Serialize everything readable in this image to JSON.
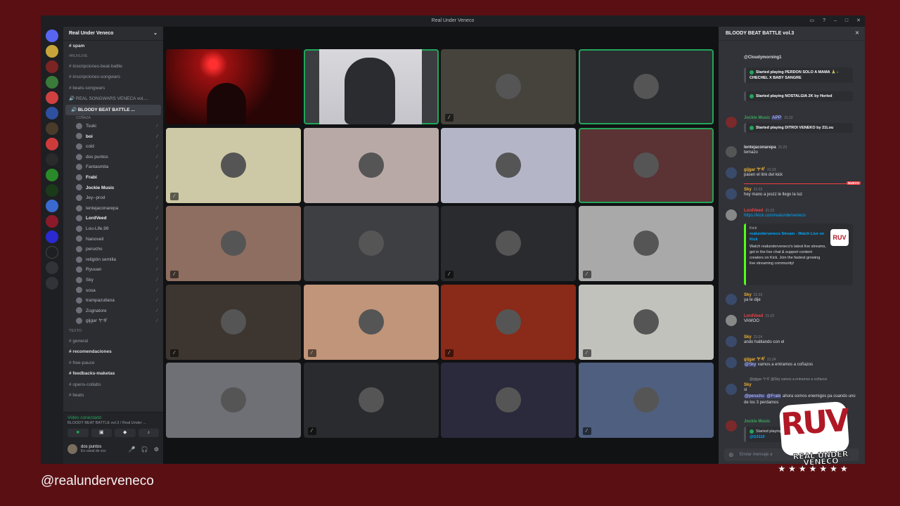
{
  "window": {
    "title": "Real Under Veneco"
  },
  "server": {
    "name": "Real Under Veneco"
  },
  "channels_top": [
    {
      "label": "spam",
      "kind": "text",
      "bright": true
    }
  ],
  "category_ruvlive": "#RUVLIVE",
  "channels_ruv": [
    {
      "label": "inscripciones-beat-battle",
      "kind": "text"
    },
    {
      "label": "inscripciones-songwars",
      "kind": "text"
    },
    {
      "label": "beats-songwars",
      "kind": "text"
    },
    {
      "label": "REAL SONGWARS VENECA vol....",
      "kind": "voice"
    }
  ],
  "active_voice": {
    "label": "BLOODY BEAT BATTLE ...",
    "sub": "COÑAZA"
  },
  "voice_users": [
    {
      "name": "Tsuki"
    },
    {
      "name": "boi",
      "bright": true
    },
    {
      "name": "cold"
    },
    {
      "name": "dos puntos"
    },
    {
      "name": "Fantasmita"
    },
    {
      "name": "Frabi",
      "bright": true
    },
    {
      "name": "Jockie Music",
      "bright": true
    },
    {
      "name": "Jey--prod"
    },
    {
      "name": "lentejaconarepa"
    },
    {
      "name": "LordVeed",
      "bright": true
    },
    {
      "name": "Lou-Life.99"
    },
    {
      "name": "Nanoveil"
    },
    {
      "name": "perucho"
    },
    {
      "name": "religión semilla"
    },
    {
      "name": "Ryuuan"
    },
    {
      "name": "Sky"
    },
    {
      "name": "sosa"
    },
    {
      "name": "trampazullana"
    },
    {
      "name": "Zognatore"
    },
    {
      "name": "gijgar ヤギ"
    }
  ],
  "category_texto": "Texto",
  "channels_texto": [
    {
      "label": "general",
      "kind": "text"
    },
    {
      "label": "recomendaciones",
      "kind": "text",
      "bright": true
    },
    {
      "label": "free-pauce",
      "kind": "text"
    },
    {
      "label": "feedbacks-maketas",
      "kind": "text",
      "bright": true
    },
    {
      "label": "opens-collabs",
      "kind": "text"
    },
    {
      "label": "beats",
      "kind": "text"
    }
  ],
  "voice_panel": {
    "status": "Video conectado",
    "channel": "BLOODY BEAT BATTLE vol.3 / Real Under ...",
    "user_name": "dos puntos",
    "user_status": "En canal de voz"
  },
  "tiles": [
    {
      "bg": "#3a0d0d",
      "speaking": false,
      "muted": false,
      "video": "red"
    },
    {
      "bg": "#3b3d40",
      "speaking": true,
      "muted": false,
      "video": "face"
    },
    {
      "bg": "#45433c",
      "speaking": false,
      "muted": true
    },
    {
      "bg": "#2b2d31",
      "speaking": true,
      "muted": false
    },
    {
      "bg": "#cdc9a6",
      "speaking": false,
      "muted": true
    },
    {
      "bg": "#b8a9a7",
      "speaking": false,
      "muted": false
    },
    {
      "bg": "#b4b6c8",
      "speaking": false,
      "muted": false
    },
    {
      "bg": "#5b3335",
      "speaking": true,
      "muted": false
    },
    {
      "bg": "#8e6e60",
      "speaking": false,
      "muted": true
    },
    {
      "bg": "#3e3f43",
      "speaking": false,
      "muted": false
    },
    {
      "bg": "#2a2b2e",
      "speaking": false,
      "muted": true
    },
    {
      "bg": "#a9a9a9",
      "speaking": false,
      "muted": true
    },
    {
      "bg": "#3d3630",
      "speaking": false,
      "muted": true
    },
    {
      "bg": "#c19579",
      "speaking": false,
      "muted": true
    },
    {
      "bg": "#8a2a18",
      "speaking": false,
      "muted": true
    },
    {
      "bg": "#c2c2bc",
      "speaking": false,
      "muted": true
    },
    {
      "bg": "#6f7075",
      "speaking": false,
      "muted": false
    },
    {
      "bg": "#2a2b2e",
      "speaking": false,
      "muted": true
    },
    {
      "bg": "#2b2a3c",
      "speaking": false,
      "muted": false
    },
    {
      "bg": "#4f5f80",
      "speaking": false,
      "muted": true
    }
  ],
  "chat": {
    "title": "BLOODY BEAT BATTLE vol.3",
    "messages": [
      {
        "author": "",
        "time": "",
        "text": "@Cloudymorning1"
      },
      {
        "author": "",
        "time": "",
        "text": "Started playing PERDON SOLO A MAMA 🙏 - CHECHEL X BABY SANGRE"
      },
      {
        "author": "",
        "time": "",
        "text": "Started playing NOSTALGIA 2K by Horled"
      },
      {
        "author": "Jockie Music",
        "time": "21:22",
        "text": "Started playing DITROI VENEKO by 21Lou",
        "color": "#3ba55d"
      },
      {
        "author": "lentejaconarepa",
        "time": "21:23",
        "text": "temazo",
        "color": "#dbdee1"
      },
      {
        "author": "gijgar ヤギ",
        "time": "21:23",
        "text": "pasen el link del kick",
        "color": "#f0b232"
      },
      {
        "author": "Sky",
        "time": "21:23",
        "text": "hey mano a jeszz le llego la luz",
        "color": "#f0b232"
      },
      {
        "author": "LordVeed",
        "time": "21:23",
        "text": "https://kick.com/realunderveneco",
        "color": "#ed4245"
      },
      {
        "author": "Sky",
        "time": "21:23",
        "text": "ya le dije",
        "color": "#f0b232"
      },
      {
        "author": "LordVeed",
        "time": "21:23",
        "text": "VAMOO",
        "color": "#ed4245"
      },
      {
        "author": "Sky",
        "time": "21:24",
        "text": "ando hablando con el",
        "color": "#f0b232"
      },
      {
        "author": "gijgar ヤギ",
        "time": "21:24",
        "text": "vamos a entramos a coñazos",
        "color": "#f0b232"
      },
      {
        "author": "Sky",
        "time": "",
        "text": "si",
        "color": "#f0b232"
      },
      {
        "author": "",
        "time": "",
        "text": "ahora somos enemigos pa cuando uno de los 3 perdamos"
      },
      {
        "author": "Jockie Music",
        "time": "",
        "text": "Started playing",
        "color": "#3ba55d"
      }
    ],
    "embed_kick": {
      "provider": "Kick",
      "title": "realunderveneco Stream - Watch Live on Kick",
      "desc": "Watch realunderveneco's latest live streams, get in the live chat & support content creators on Kick. Join the fastest growing live streaming community!"
    },
    "new_label": "NUEVO",
    "reply_text": "@gijgar ヤギ @Sky vamos a entramos a coñazos",
    "mention_sky": "@Sky",
    "mention_perucho": "@perucho",
    "mention_frabi": "@Frabi",
    "app_badge": "APP",
    "last_track": "@G3110",
    "input_placeholder": "Enviar mensaje a"
  },
  "overlay": {
    "handle": "@realunderveneco",
    "logo_letters": "RUV",
    "logo_sub": "REAL UNDER VENECO",
    "logo_stars": "★★★★★★★"
  },
  "colors": {
    "speaking": "#23a55a",
    "background": "#5a0f12",
    "accent": "#b01826"
  }
}
